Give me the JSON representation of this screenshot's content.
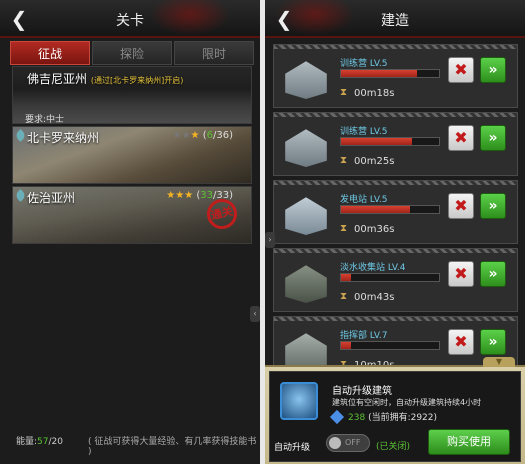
{
  "left": {
    "back_icon": "chevron-left-icon",
    "title": "关卡",
    "tabs": [
      {
        "label": "征战",
        "active": true
      },
      {
        "label": "探险",
        "active": false
      },
      {
        "label": "限时",
        "active": false
      }
    ],
    "stages": [
      {
        "name": "佛吉尼亚州",
        "note": "(通过[北卡罗来纳州]开启)",
        "requirement": "要求:中士",
        "locked": true
      },
      {
        "name": "北卡罗来纳州",
        "stars_on": 1,
        "stars_total": 3,
        "progress": "(6/36)",
        "progress_count": "6",
        "progress_total": "36"
      },
      {
        "name": "佐治亚州",
        "stars_on": 3,
        "stars_total": 3,
        "progress": "(33/33)",
        "progress_count": "33",
        "progress_total": "33",
        "stamp": "通关"
      }
    ],
    "energy_label": "能量:",
    "energy_value": "57",
    "energy_max": "/20",
    "hint": "( 征战可获得大量经验、有几率获得技能书 )"
  },
  "right": {
    "back_icon": "chevron-left-icon",
    "title": "建造",
    "buildings": [
      {
        "name": "训练营 LV.5",
        "progress": 0.78,
        "time": "00m18s"
      },
      {
        "name": "训练营 LV.5",
        "progress": 0.72,
        "time": "00m25s"
      },
      {
        "name": "发电站 LV.5",
        "progress": 0.7,
        "time": "00m36s"
      },
      {
        "name": "淡水收集站 LV.4",
        "progress": 0.1,
        "time": "00m43s"
      },
      {
        "name": "指挥部 LV.7",
        "progress": 0.1,
        "time": "10m10s"
      }
    ],
    "cancel_symbol": "✖",
    "speedup_symbol": "»",
    "popup": {
      "title": "自动升级建筑",
      "desc": "建筑位有空闲时，自动升级建筑持续4小时",
      "cost": "238",
      "owned": "(当前拥有:2922)",
      "auto_label": "自动升级",
      "toggle_text": "OFF",
      "state": "(已关闭)",
      "buy_label": "购买使用"
    }
  },
  "colors": {
    "accent_red": "#b12a22",
    "green": "#5bc234",
    "name_blue": "#6ec9e6"
  }
}
